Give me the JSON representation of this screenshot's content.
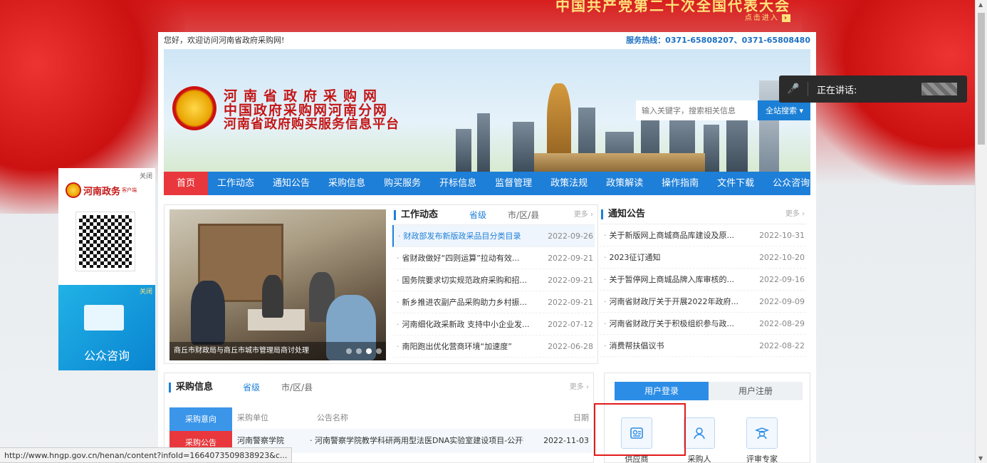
{
  "banner": {
    "title": "中国共产党第二十次全国代表大会",
    "enter": "点击进入"
  },
  "top": {
    "welcome": "您好，欢迎访问河南省政府采购网!",
    "hotline": "服务热线：0371-65808207、0371-65808480"
  },
  "header": {
    "title_line1": "河南省政府采购网",
    "title_line2": "中国政府采购网河南分网",
    "title_line3": "河南省政府购买服务信息平台",
    "search_placeholder": "输入关键字，搜索相关信息",
    "search_button": "全站搜索 ▾"
  },
  "nav": [
    "首页",
    "工作动态",
    "通知公告",
    "采购信息",
    "购买服务",
    "开标信息",
    "监督管理",
    "政策法规",
    "政策解读",
    "操作指南",
    "文件下载",
    "公众咨询"
  ],
  "carousel": {
    "caption": "商丘市财政局与商丘市城市管理局商讨处理"
  },
  "work_news": {
    "title": "工作动态",
    "tab1": "省级",
    "tab2": "市/区/县",
    "more": "更多 ›",
    "items": [
      {
        "text": "财政部发布新版政采品目分类目录",
        "date": "2022-09-26"
      },
      {
        "text": "省财政做好“四则运算”拉动有效...",
        "date": "2022-09-21"
      },
      {
        "text": "国务院要求切实规范政府采购和招...",
        "date": "2022-09-21"
      },
      {
        "text": "新乡推进农副产品采购助力乡村振...",
        "date": "2022-09-21"
      },
      {
        "text": "河南细化政采新政 支持中小企业发...",
        "date": "2022-07-12"
      },
      {
        "text": "南阳跑出优化营商环境“加速度”",
        "date": "2022-06-28"
      }
    ]
  },
  "notices": {
    "title": "通知公告",
    "more": "更多 ›",
    "items": [
      {
        "text": "关于新版网上商城商品库建设及原...",
        "date": "2022-10-31"
      },
      {
        "text": "2023征订通知",
        "date": "2022-10-20"
      },
      {
        "text": "关于暂停网上商城品牌入库审核的...",
        "date": "2022-09-16"
      },
      {
        "text": "河南省财政厅关于开展2022年政府...",
        "date": "2022-09-09"
      },
      {
        "text": "河南省财政厅关于积极组织参与政...",
        "date": "2022-08-29"
      },
      {
        "text": "消费帮扶倡议书",
        "date": "2022-08-22"
      }
    ]
  },
  "purchase": {
    "title": "采购信息",
    "tab1": "省级",
    "tab2": "市/区/县",
    "more": "更多 ›",
    "side_tab1": "采购意向",
    "side_tab2": "采购公告",
    "col_unit": "采购单位",
    "col_name": "公告名称",
    "col_date": "日期",
    "row_unit": "河南警察学院",
    "row_name": "· 河南警察学院教学科研两用型法医DNA实验室建设项目-公开招...",
    "row_date": "2022-11-03"
  },
  "login": {
    "tab_login": "用户登录",
    "tab_register": "用户注册",
    "roles": [
      "供应商",
      "采购人",
      "评审专家"
    ]
  },
  "float_ad": {
    "close": "关闭",
    "brand": "河南政务",
    "brand_sub": "客户端",
    "consult_close": "关闭",
    "consult_label": "公众咨询"
  },
  "speaking": {
    "label": "正在讲话:"
  },
  "status_url": "http://www.hngp.gov.cn/henan/content?infoId=1664073509838923&c..."
}
